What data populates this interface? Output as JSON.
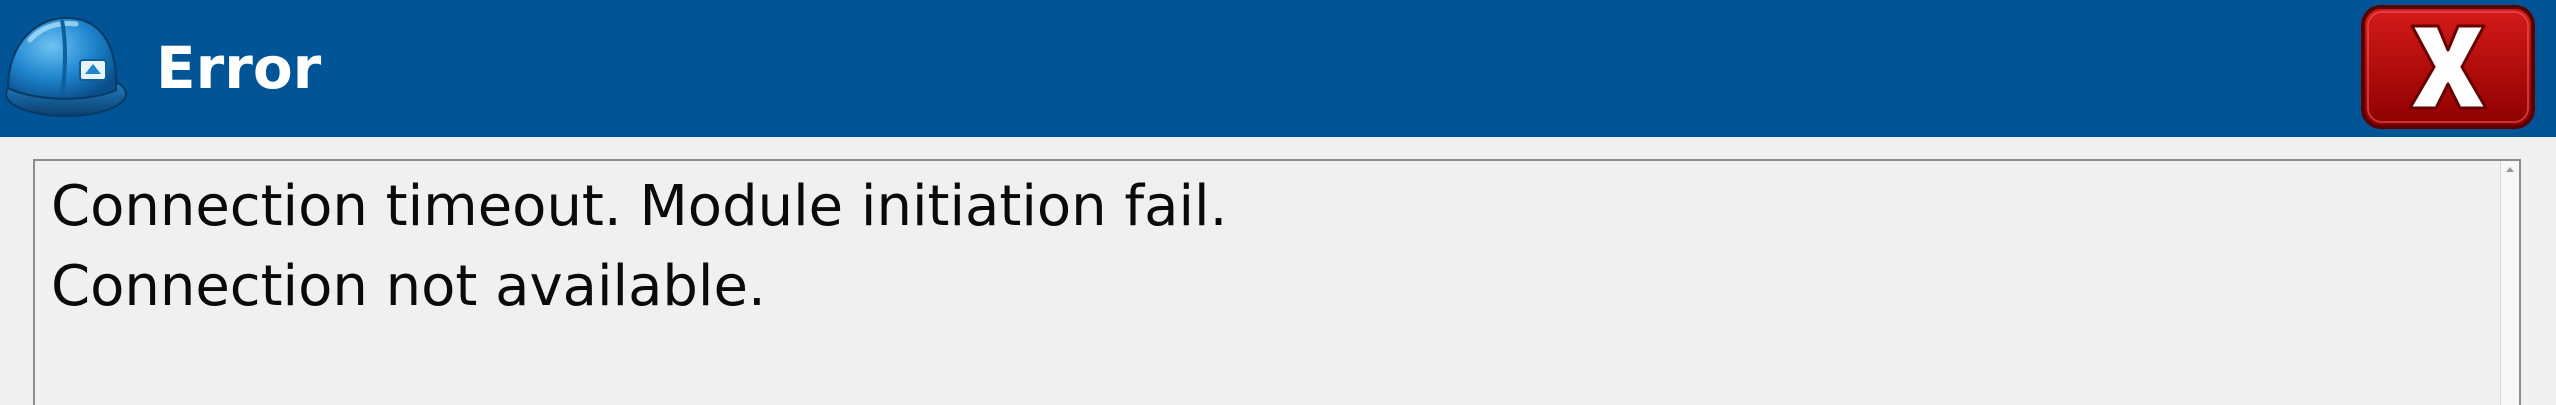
{
  "window": {
    "title": "Error",
    "colors": {
      "titlebar": "#015496",
      "title_text": "#ffffff",
      "close_button": "#b80000",
      "background": "#f0f0f0"
    }
  },
  "icons": {
    "app": "hard-hat-icon",
    "close": "close-x-icon",
    "scroll_up": "scroll-up-arrow-icon"
  },
  "message": {
    "lines": [
      "Connection timeout. Module initiation fail.",
      "Connection not available."
    ]
  }
}
